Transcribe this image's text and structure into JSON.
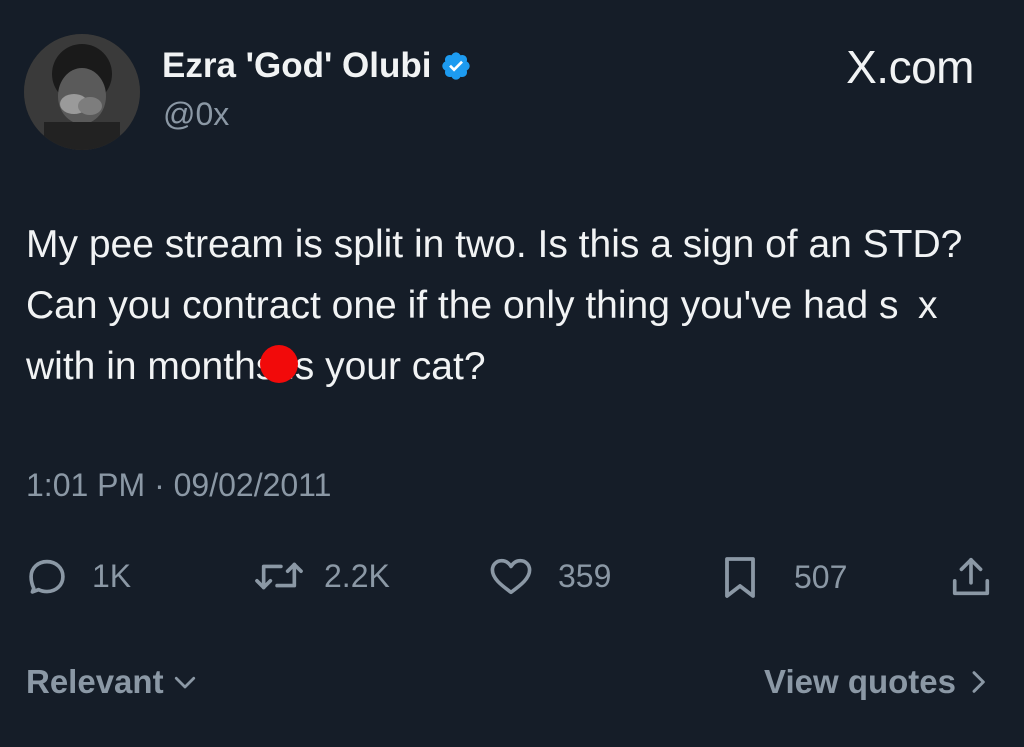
{
  "author": {
    "display_name": "Ezra 'God' Olubi",
    "handle": "@0x",
    "verified_icon": "verified-badge-icon"
  },
  "brand": {
    "label": "X.com"
  },
  "tweet": {
    "text": "My pee stream is split in two. Is this a sign of an STD? Can you contract one if the only thing you've had s x with in months is your cat?",
    "timestamp": "1:01 PM · 09/02/2011"
  },
  "metrics": {
    "replies": "1K",
    "reposts": "2.2K",
    "likes": "359",
    "bookmarks": "507"
  },
  "footer": {
    "sort_label": "Relevant",
    "quotes_label": "View quotes"
  },
  "colors": {
    "background": "#151d28",
    "text_primary": "#f1f3f4",
    "text_secondary": "#8b98a5",
    "verified_blue": "#1d9bf0",
    "redaction_red": "#f20a0a"
  },
  "icons": [
    "reply-icon",
    "repost-icon",
    "like-icon",
    "bookmark-icon",
    "share-icon",
    "chevron-down-icon",
    "chevron-right-icon"
  ]
}
